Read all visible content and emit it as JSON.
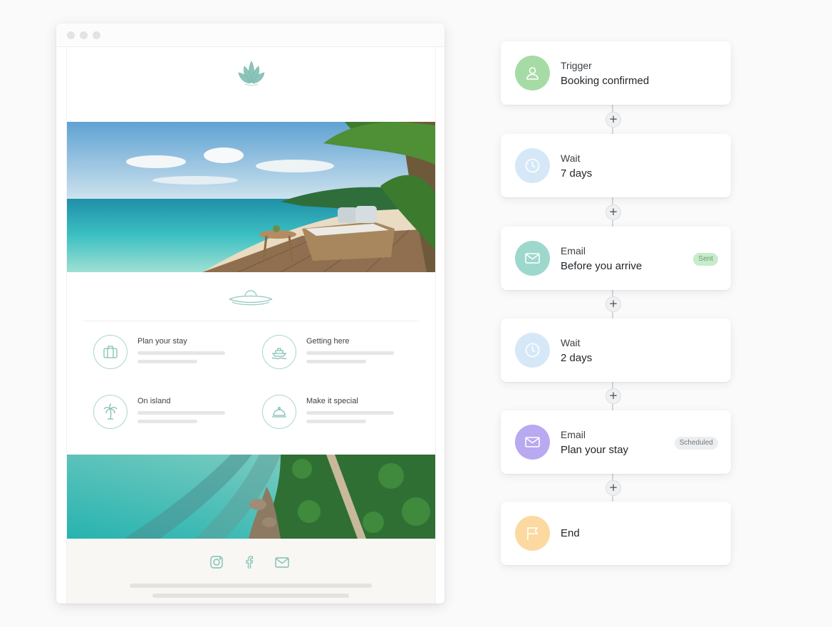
{
  "email_preview": {
    "features": [
      {
        "title": "Plan your stay",
        "icon": "luggage-icon"
      },
      {
        "title": "Getting here",
        "icon": "boat-icon"
      },
      {
        "title": "On island",
        "icon": "palm-tree-icon"
      },
      {
        "title": "Make it special",
        "icon": "cloche-icon"
      }
    ],
    "footer_icons": [
      "instagram-icon",
      "facebook-icon",
      "mail-icon"
    ],
    "colors": {
      "accent": "#7fbfb3"
    }
  },
  "workflow": {
    "add_step_label": "+",
    "steps": [
      {
        "type": "Trigger",
        "value": "Booking confirmed",
        "icon": "user-icon",
        "color": "#a6dba6"
      },
      {
        "type": "Wait",
        "value": "7 days",
        "icon": "clock-icon",
        "color": "#d6e8f8"
      },
      {
        "type": "Email",
        "value": "Before you arrive",
        "icon": "mail-icon",
        "color": "#9ed8cc",
        "badge": "Sent"
      },
      {
        "type": "Wait",
        "value": "2 days",
        "icon": "clock-icon",
        "color": "#d6e8f8"
      },
      {
        "type": "Email",
        "value": "Plan your stay",
        "icon": "mail-icon",
        "color": "#b9a9f0",
        "badge": "Scheduled"
      },
      {
        "type": "",
        "value": "End",
        "icon": "flag-icon",
        "color": "#fbd9a0"
      }
    ],
    "badge_colors": {
      "Sent": "#c7eccb",
      "Scheduled": "#eceef0"
    }
  }
}
